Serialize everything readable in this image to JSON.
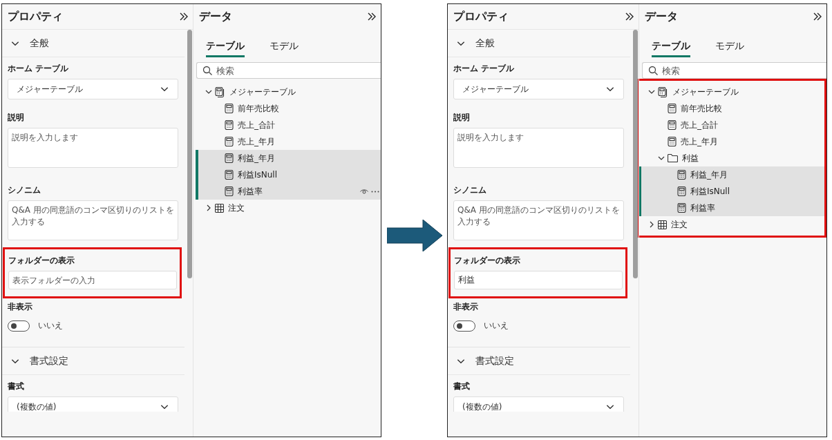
{
  "screens": [
    {
      "properties": {
        "title": "プロパティ",
        "general_section": {
          "title": "全般",
          "expanded": true
        },
        "home_table": {
          "label": "ホーム テーブル",
          "value": "メジャーテーブル"
        },
        "description": {
          "label": "説明",
          "placeholder": "説明を入力します"
        },
        "synonyms": {
          "label": "シノニム",
          "placeholder": "Q&A 用の同意語のコンマ区切りのリストを入力する"
        },
        "display_folder": {
          "label": "フォルダーの表示",
          "placeholder": "表示フォルダーの入力",
          "highlighted": true
        },
        "hidden": {
          "label": "非表示",
          "on": false,
          "reading": "いいえ"
        },
        "format_section": {
          "title": "書式設定",
          "expanded": true
        },
        "format": {
          "label": "書式",
          "value": "(複数の値)"
        }
      },
      "data": {
        "title": "データ",
        "tabs": [
          {
            "label": "テーブル",
            "selected": true
          },
          {
            "label": "モデル",
            "selected": false
          }
        ],
        "search": {
          "placeholder": "検索"
        },
        "tree_highlighted": false,
        "tree": [
          {
            "label": "メジャーテーブル",
            "kind": "measure_table",
            "expanded": true,
            "selected": false,
            "hovered": false,
            "children": [
              {
                "label": "前年売比較",
                "kind": "measure",
                "selected": false,
                "hovered": false
              },
              {
                "label": "売上_合計",
                "kind": "measure",
                "selected": false,
                "hovered": false
              },
              {
                "label": "売上_年月",
                "kind": "measure",
                "selected": false,
                "hovered": false
              },
              {
                "label": "利益_年月",
                "kind": "measure",
                "selected": true,
                "hovered": false
              },
              {
                "label": "利益IsNull",
                "kind": "measure",
                "selected": true,
                "hovered": false
              },
              {
                "label": "利益率",
                "kind": "measure",
                "selected": true,
                "hovered": true
              }
            ]
          },
          {
            "label": "注文",
            "kind": "table",
            "expanded": false,
            "selected": false,
            "hovered": false
          }
        ]
      }
    },
    {
      "properties": {
        "title": "プロパティ",
        "general_section": {
          "title": "全般",
          "expanded": true
        },
        "home_table": {
          "label": "ホーム テーブル",
          "value": "メジャーテーブル"
        },
        "description": {
          "label": "説明",
          "placeholder": "説明を入力します"
        },
        "synonyms": {
          "label": "シノニム",
          "placeholder": "Q&A 用の同意語のコンマ区切りのリストを入力する"
        },
        "display_folder": {
          "label": "フォルダーの表示",
          "value": "利益",
          "highlighted": true
        },
        "hidden": {
          "label": "非表示",
          "on": false,
          "reading": "いいえ"
        },
        "format_section": {
          "title": "書式設定",
          "expanded": true
        },
        "format": {
          "label": "書式",
          "value": "(複数の値)"
        }
      },
      "data": {
        "title": "データ",
        "tabs": [
          {
            "label": "テーブル",
            "selected": true
          },
          {
            "label": "モデル",
            "selected": false
          }
        ],
        "search": {
          "placeholder": "検索"
        },
        "tree_highlighted": true,
        "tree": [
          {
            "label": "メジャーテーブル",
            "kind": "measure_table",
            "expanded": true,
            "selected": false,
            "hovered": false,
            "children": [
              {
                "label": "前年売比較",
                "kind": "measure",
                "selected": false,
                "hovered": false
              },
              {
                "label": "売上_合計",
                "kind": "measure",
                "selected": false,
                "hovered": false
              },
              {
                "label": "売上_年月",
                "kind": "measure",
                "selected": false,
                "hovered": false
              },
              {
                "label": "利益",
                "kind": "folder",
                "expanded": true,
                "selected": false,
                "hovered": false,
                "children": [
                  {
                    "label": "利益_年月",
                    "kind": "measure",
                    "selected": true,
                    "hovered": false
                  },
                  {
                    "label": "利益IsNull",
                    "kind": "measure",
                    "selected": true,
                    "hovered": false
                  },
                  {
                    "label": "利益率",
                    "kind": "measure",
                    "selected": true,
                    "hovered": false
                  }
                ]
              }
            ]
          },
          {
            "label": "注文",
            "kind": "table",
            "expanded": false,
            "selected": false,
            "hovered": false
          }
        ]
      }
    }
  ]
}
